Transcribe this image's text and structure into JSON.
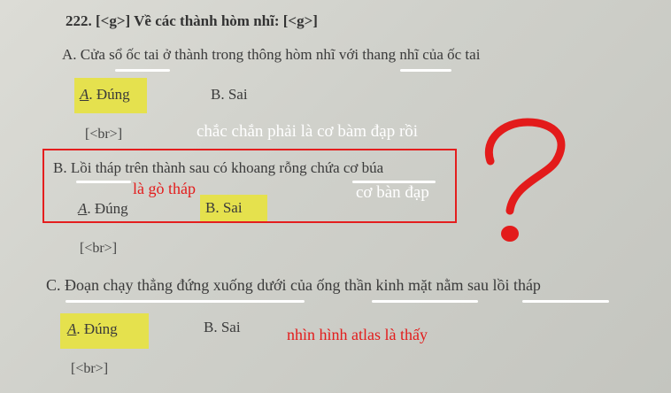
{
  "question": {
    "title": "222. [<g>] Về các thành hòm nhĩ: [<g>]",
    "options": [
      {
        "text": "A. Cửa sổ ốc tai ở thành trong thông hòm nhĩ với thang nhĩ của ốc tai",
        "answer_true": "Đúng",
        "answer_true_letter": "A",
        "answer_false": "B. Sai",
        "selected": "Đúng",
        "br": "[<br>]"
      },
      {
        "text": "B. Lồi tháp trên thành sau có khoang rỗng chứa cơ búa",
        "answer_true": "Đúng",
        "answer_true_letter": "A",
        "answer_false": "B. Sai",
        "selected": "Sai",
        "br": "[<br>]"
      },
      {
        "text": "C. Đoạn chạy thẳng đứng xuống dưới của ống thần kinh mặt nằm sau lồi tháp",
        "answer_true": "Đúng",
        "answer_true_letter": "A",
        "answer_false": "B. Sai",
        "selected": "Đúng",
        "br": "[<br>]"
      }
    ]
  },
  "annotations": {
    "note_top": "chắc chắn phải là cơ bàm đạp rồi",
    "note_go_thap": "là gò tháp",
    "note_co_ban_dap": "cơ bàn đạp",
    "note_atlas": "nhìn hình atlas là thấy",
    "mark": "?"
  },
  "colors": {
    "highlight": "#e7e23f",
    "ink_red": "#e31b1b",
    "ink_white": "#ffffff"
  }
}
